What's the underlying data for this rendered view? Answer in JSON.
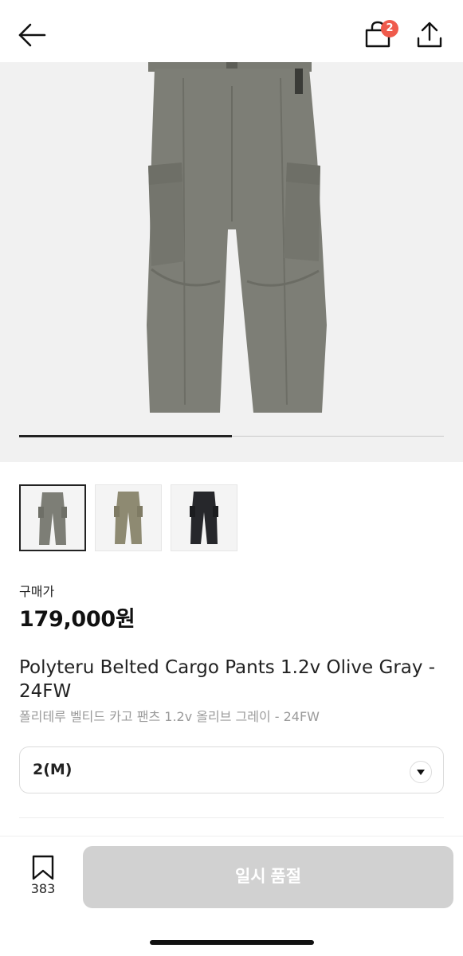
{
  "header": {
    "back_icon": "arrow-left-icon",
    "cart_icon": "shopping-bag-icon",
    "cart_badge": "2",
    "share_icon": "share-upload-icon",
    "badge_color": "#ef5b4c"
  },
  "gallery": {
    "progress_fraction": 0.5,
    "main_image": "olive-gray-cargo-pants",
    "thumbnails": [
      {
        "color": "olive-gray",
        "selected": true
      },
      {
        "color": "khaki",
        "selected": false
      },
      {
        "color": "black",
        "selected": false
      }
    ]
  },
  "product": {
    "price_label": "구매가",
    "price": "179,000원",
    "title_en": "Polyteru Belted Cargo Pants 1.2v Olive Gray - 24FW",
    "title_ko": "폴리테루 벨티드 카고 팬츠 1.2v 올리브 그레이 - 24FW"
  },
  "size_select": {
    "value": "2(M)",
    "arrow_icon": "caret-down-icon"
  },
  "footer": {
    "bookmark_icon": "bookmark-icon",
    "bookmark_count": "383",
    "soldout_label": "일시 품절"
  }
}
